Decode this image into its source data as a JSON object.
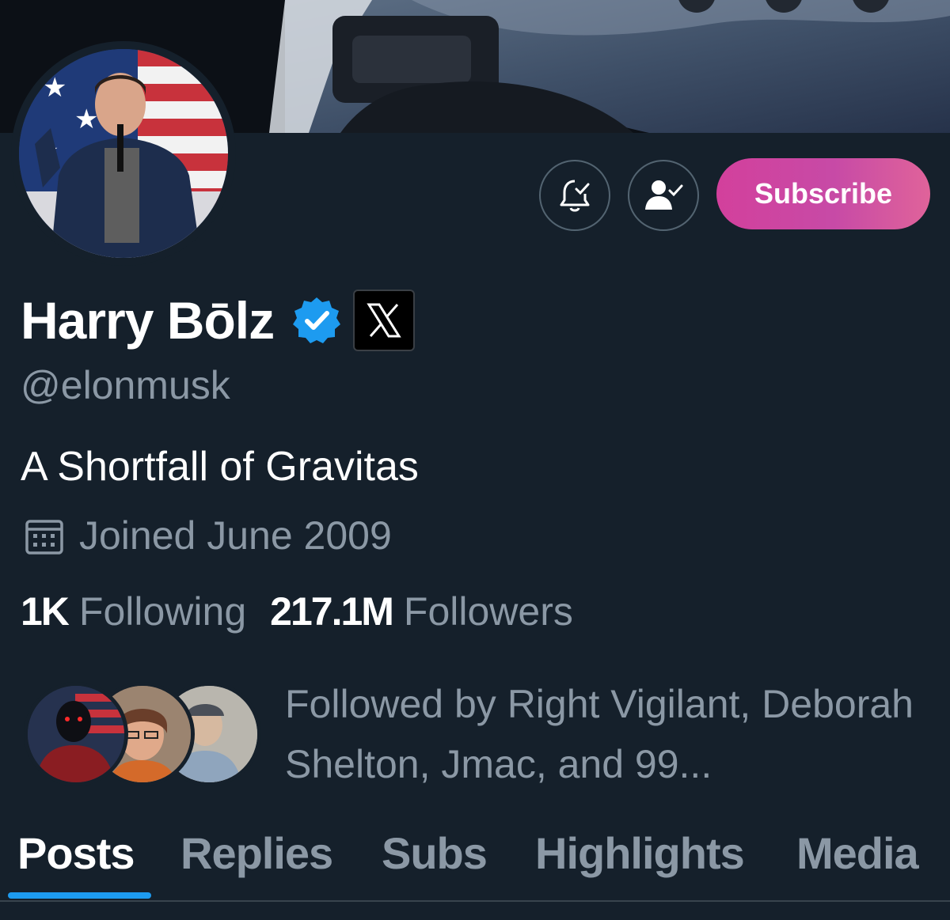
{
  "profile": {
    "display_name": "Harry Bōlz",
    "handle": "@elonmusk",
    "bio": "A Shortfall of Gravitas",
    "joined": "Joined June 2009",
    "x_badge": "X"
  },
  "actions": {
    "subscribe_label": "Subscribe",
    "notify_icon": "bell-check-icon",
    "follow_icon": "person-check-icon"
  },
  "stats": {
    "following_count": "1K",
    "following_label": "Following",
    "followers_count": "217.1M",
    "followers_label": "Followers"
  },
  "followed_by": {
    "text": "Followed by Right Vigilant, Deborah Shelton, Jmac, and 99..."
  },
  "tabs": [
    {
      "label": "Posts",
      "active": true
    },
    {
      "label": "Replies",
      "active": false
    },
    {
      "label": "Subs",
      "active": false
    },
    {
      "label": "Highlights",
      "active": false
    },
    {
      "label": "Media",
      "active": false
    }
  ],
  "colors": {
    "background": "#15202b",
    "muted_text": "#8b98a5",
    "accent_blue": "#1d9bf0",
    "subscribe_gradient_start": "#d3409c",
    "subscribe_gradient_end": "#e0639a"
  }
}
